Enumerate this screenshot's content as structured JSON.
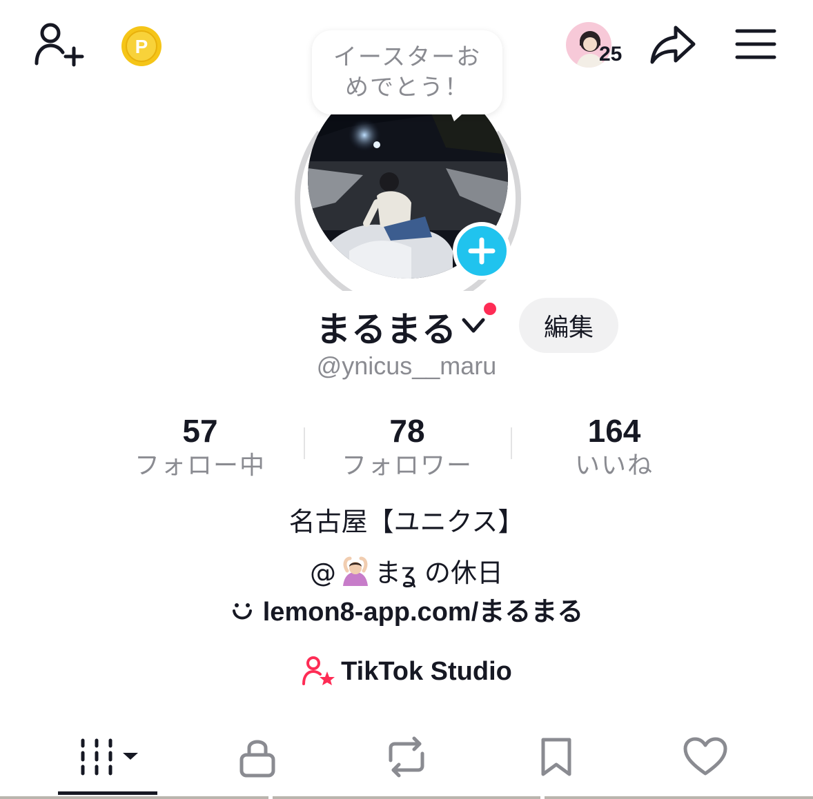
{
  "topbar": {
    "add_friend_icon": "add-user-icon",
    "coin_icon": "coin-icon",
    "coin_letter": "P",
    "mini_avatar_count": "25",
    "share_icon": "share-icon",
    "menu_icon": "menu-icon"
  },
  "bubble": {
    "line1": "イースターお",
    "line2": "めでとう！"
  },
  "profile": {
    "display_name": "まるまる",
    "handle": "@ynicus__maru",
    "edit_label": "編集"
  },
  "stats": [
    {
      "value": "57",
      "label": "フォロー中"
    },
    {
      "value": "78",
      "label": "フォロワー"
    },
    {
      "value": "164",
      "label": "いいね"
    }
  ],
  "bio": {
    "line1": "名古屋【ユニクス】",
    "line2_prefix": "@",
    "line2_suffix": "まʓ の休日",
    "link": "lemon8-app.com/まるまる"
  },
  "studio": {
    "label": "TikTok Studio"
  },
  "tabs": [
    {
      "name": "videos",
      "icon": "grid-icon"
    },
    {
      "name": "private",
      "icon": "lock-icon"
    },
    {
      "name": "reposts",
      "icon": "repost-icon"
    },
    {
      "name": "favorites",
      "icon": "bookmark-icon"
    },
    {
      "name": "liked",
      "icon": "heart-icon"
    }
  ],
  "colors": {
    "accent_red": "#fe2c55",
    "accent_blue": "#20c3ee",
    "text_primary": "#161823",
    "text_secondary": "#8a8b91",
    "coin_gold": "#f5c518"
  }
}
